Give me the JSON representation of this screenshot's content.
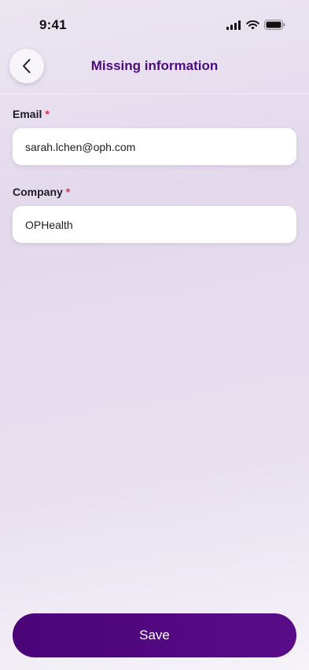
{
  "status_bar": {
    "time": "9:41"
  },
  "header": {
    "title": "Missing information"
  },
  "form": {
    "email": {
      "label": "Email",
      "required_mark": "*",
      "value": "sarah.lchen@oph.com"
    },
    "company": {
      "label": "Company",
      "required_mark": "*",
      "value": "OPHealth"
    }
  },
  "footer": {
    "save_label": "Save"
  },
  "colors": {
    "accent": "#4b0a7e",
    "required": "#e0364a",
    "button": "#500880"
  }
}
